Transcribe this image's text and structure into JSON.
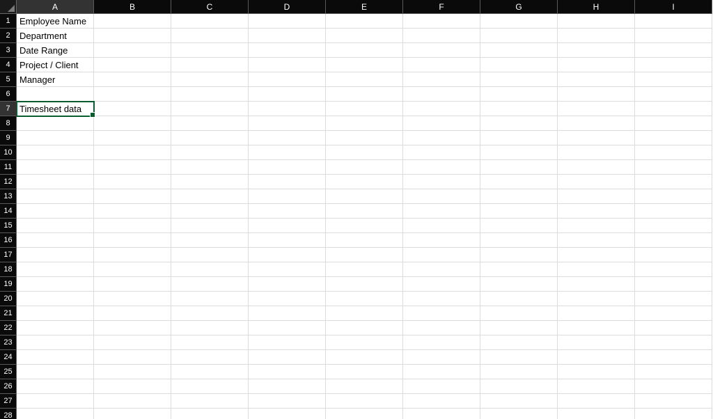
{
  "columns": [
    "A",
    "B",
    "C",
    "D",
    "E",
    "F",
    "G",
    "H",
    "I"
  ],
  "row_count": 28,
  "active_cell": {
    "row": 7,
    "col": "A"
  },
  "cells": {
    "A1": "Employee Name",
    "A2": "Department",
    "A3": "Date Range",
    "A4": "Project / Client",
    "A5": "Manager",
    "A6": "",
    "A7": "Timesheet data"
  }
}
